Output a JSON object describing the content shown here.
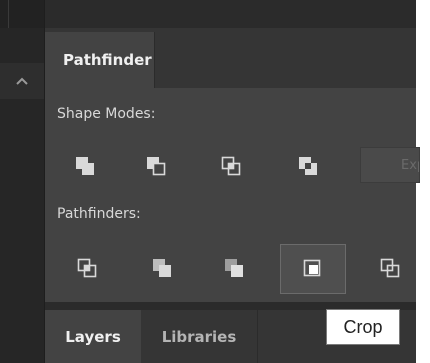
{
  "panel": {
    "active_tab": "Pathfinder",
    "shape_modes_label": "Shape Modes:",
    "pathfinders_label": "Pathfinders:",
    "expand_label": "Expand"
  },
  "icons": {
    "shape_modes": [
      "unite-icon",
      "minus-front-icon",
      "intersect-icon",
      "exclude-icon"
    ],
    "pathfinders": [
      "divide-icon",
      "trim-icon",
      "merge-icon",
      "crop-icon",
      "outline-icon"
    ]
  },
  "bottom_tabs": [
    "Layers",
    "Libraries"
  ],
  "tooltip": "Crop",
  "colors": {
    "panel_bg": "#434343",
    "icon_fill": "#d9d9d9",
    "tooltip_bg": "#ffffff"
  }
}
